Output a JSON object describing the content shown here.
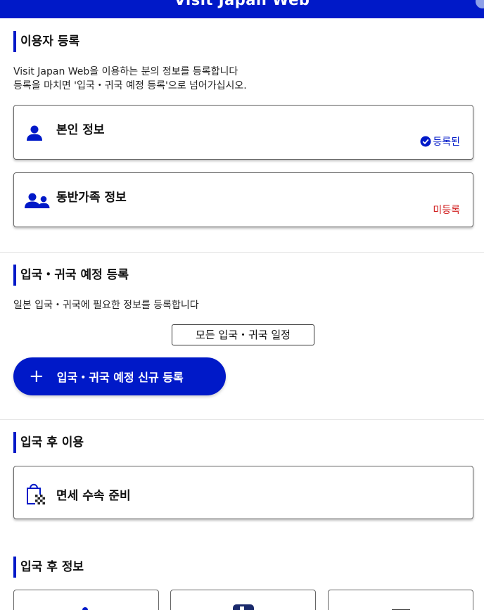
{
  "header": {
    "title": "Visit Japan Web"
  },
  "user_registration": {
    "title": "이용자 등록",
    "desc_line1": "Visit Japan Web을 이용하는 분의 정보를 등록합니다",
    "desc_line2": "등록을 마치면 '입국・귀국 예정 등록'으로 넘어가십시오.",
    "cards": [
      {
        "label": "본인 정보",
        "status": "등록된",
        "icon": "person-icon"
      },
      {
        "label": "동반가족 정보",
        "status": "미등록",
        "icon": "family-icon"
      }
    ]
  },
  "entry_schedule": {
    "title": "입국・귀국 예정 등록",
    "desc": "일본 입국・귀국에 필요한 정보를 등록합니다",
    "all_schedules_label": "모든 입국・귀국 일정",
    "new_button_label": "입국・귀국 예정 신규 등록"
  },
  "after_entry_use": {
    "title": "입국 후 이용",
    "cards": [
      {
        "label": "면세 수속 준비",
        "icon": "tax-free-bag-icon"
      }
    ]
  },
  "after_entry_info": {
    "title": "입국 후 정보"
  },
  "colors": {
    "brand": "#0019c8",
    "registered": "#0019c8",
    "unregistered": "#d01c1c"
  }
}
